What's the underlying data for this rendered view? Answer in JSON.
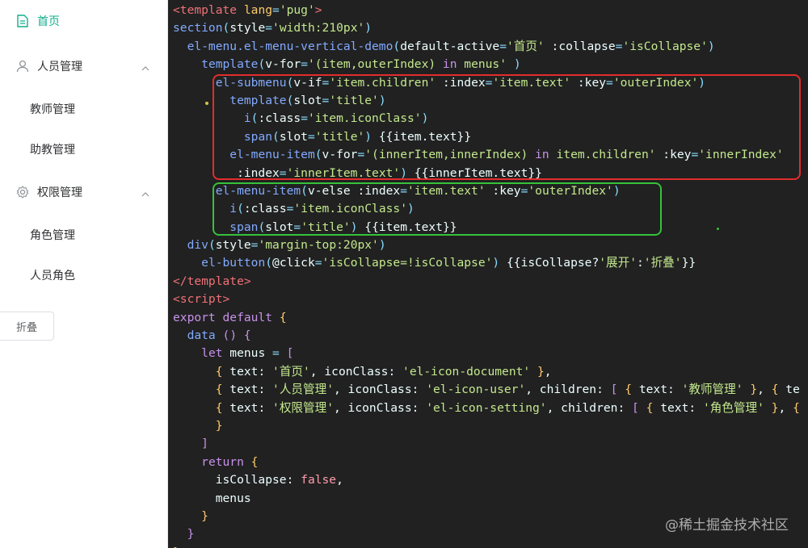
{
  "sidebar": {
    "items": [
      {
        "label": "首页",
        "icon": "document-icon",
        "active": true
      },
      {
        "label": "人员管理",
        "icon": "user-icon",
        "children": [
          "教师管理",
          "助教管理"
        ]
      },
      {
        "label": "权限管理",
        "icon": "setting-icon",
        "children": [
          "角色管理",
          "人员角色"
        ]
      }
    ],
    "collapse_button": "折叠",
    "accent_color": "#13ae8c"
  },
  "editor": {
    "lines": [
      [
        [
          "tag",
          "<template "
        ],
        [
          "prop",
          "lang"
        ],
        [
          "punc",
          "="
        ],
        [
          "str",
          "'pug'"
        ],
        [
          "tag",
          ">"
        ]
      ],
      [
        [
          "fn",
          "section"
        ],
        [
          "punc",
          "("
        ],
        [
          "plain",
          "style"
        ],
        [
          "punc",
          "="
        ],
        [
          "str",
          "'width:210px'"
        ],
        [
          "punc",
          ")"
        ]
      ],
      [
        [
          "plain",
          "  "
        ],
        [
          "fn",
          "el-menu.el-menu-vertical-demo"
        ],
        [
          "punc",
          "("
        ],
        [
          "plain",
          "default-active"
        ],
        [
          "punc",
          "="
        ],
        [
          "str",
          "'首页'"
        ],
        [
          "plain",
          " :collapse"
        ],
        [
          "punc",
          "="
        ],
        [
          "str",
          "'isCollapse'"
        ],
        [
          "punc",
          ")"
        ]
      ],
      [
        [
          "plain",
          "    "
        ],
        [
          "fn",
          "template"
        ],
        [
          "punc",
          "("
        ],
        [
          "plain",
          "v-for"
        ],
        [
          "punc",
          "="
        ],
        [
          "str",
          "'(item,outerIndex) "
        ],
        [
          "kw",
          "in"
        ],
        [
          "str",
          " menus'"
        ],
        [
          "plain",
          " "
        ],
        [
          "punc",
          ")"
        ]
      ],
      [
        [
          "plain",
          "      "
        ],
        [
          "fn",
          "el-submenu"
        ],
        [
          "punc",
          "("
        ],
        [
          "plain",
          "v-if"
        ],
        [
          "punc",
          "="
        ],
        [
          "str",
          "'item.children'"
        ],
        [
          "plain",
          " :index"
        ],
        [
          "punc",
          "="
        ],
        [
          "str",
          "'item.text'"
        ],
        [
          "plain",
          " :key"
        ],
        [
          "punc",
          "="
        ],
        [
          "str",
          "'outerIndex'"
        ],
        [
          "punc",
          ")"
        ]
      ],
      [
        [
          "plain",
          "        "
        ],
        [
          "fn",
          "template"
        ],
        [
          "punc",
          "("
        ],
        [
          "plain",
          "slot"
        ],
        [
          "punc",
          "="
        ],
        [
          "str",
          "'title'"
        ],
        [
          "punc",
          ")"
        ]
      ],
      [
        [
          "plain",
          "          "
        ],
        [
          "fn",
          "i"
        ],
        [
          "punc",
          "("
        ],
        [
          "plain",
          ":class"
        ],
        [
          "punc",
          "="
        ],
        [
          "str",
          "'item.iconClass'"
        ],
        [
          "punc",
          ")"
        ]
      ],
      [
        [
          "plain",
          "          "
        ],
        [
          "fn",
          "span"
        ],
        [
          "punc",
          "("
        ],
        [
          "plain",
          "slot"
        ],
        [
          "punc",
          "="
        ],
        [
          "str",
          "'title'"
        ],
        [
          "punc",
          ")"
        ],
        [
          "plain",
          " {{item.text}}"
        ]
      ],
      [
        [
          "plain",
          "        "
        ],
        [
          "fn",
          "el-menu-item"
        ],
        [
          "punc",
          "("
        ],
        [
          "plain",
          "v-for"
        ],
        [
          "punc",
          "="
        ],
        [
          "str",
          "'(innerItem,innerIndex) "
        ],
        [
          "kw",
          "in"
        ],
        [
          "str",
          " item.children'"
        ],
        [
          "plain",
          " :key"
        ],
        [
          "punc",
          "="
        ],
        [
          "str",
          "'innerIndex'"
        ]
      ],
      [
        [
          "plain",
          "         :index"
        ],
        [
          "punc",
          "="
        ],
        [
          "str",
          "'innerItem.text'"
        ],
        [
          "punc",
          ")"
        ],
        [
          "plain",
          " {{innerItem.text}}"
        ]
      ],
      [
        [
          "plain",
          "      "
        ],
        [
          "fn",
          "el-menu-item"
        ],
        [
          "punc",
          "("
        ],
        [
          "plain",
          "v-else :index"
        ],
        [
          "punc",
          "="
        ],
        [
          "str",
          "'item.text'"
        ],
        [
          "plain",
          " :key"
        ],
        [
          "punc",
          "="
        ],
        [
          "str",
          "'outerIndex'"
        ],
        [
          "punc",
          ")"
        ]
      ],
      [
        [
          "plain",
          "        "
        ],
        [
          "fn",
          "i"
        ],
        [
          "punc",
          "("
        ],
        [
          "plain",
          ":class"
        ],
        [
          "punc",
          "="
        ],
        [
          "str",
          "'item.iconClass'"
        ],
        [
          "punc",
          ")"
        ]
      ],
      [
        [
          "plain",
          "        "
        ],
        [
          "fn",
          "span"
        ],
        [
          "punc",
          "("
        ],
        [
          "plain",
          "slot"
        ],
        [
          "punc",
          "="
        ],
        [
          "str",
          "'title'"
        ],
        [
          "punc",
          ")"
        ],
        [
          "plain",
          " {{item.text}}"
        ]
      ],
      [
        [
          "plain",
          "  "
        ],
        [
          "fn",
          "div"
        ],
        [
          "punc",
          "("
        ],
        [
          "plain",
          "style"
        ],
        [
          "punc",
          "="
        ],
        [
          "str",
          "'margin-top:20px'"
        ],
        [
          "punc",
          ")"
        ]
      ],
      [
        [
          "plain",
          "    "
        ],
        [
          "fn",
          "el-button"
        ],
        [
          "punc",
          "("
        ],
        [
          "plain",
          "@click"
        ],
        [
          "punc",
          "="
        ],
        [
          "str",
          "'isCollapse=!isCollapse'"
        ],
        [
          "punc",
          ")"
        ],
        [
          "plain",
          " {{isCollapse?"
        ],
        [
          "str",
          "'展开'"
        ],
        [
          "plain",
          ":"
        ],
        [
          "str",
          "'折叠'"
        ],
        [
          "plain",
          "}}"
        ]
      ],
      [
        [
          "tag",
          "</template>"
        ]
      ],
      [
        [
          "tag",
          "<script>"
        ]
      ],
      [
        [
          "kw",
          "export default"
        ],
        [
          "plain",
          " "
        ],
        [
          "prop",
          "{"
        ]
      ],
      [
        [
          "plain",
          "  "
        ],
        [
          "fn",
          "data"
        ],
        [
          "plain",
          " "
        ],
        [
          "kw",
          "()"
        ],
        [
          "plain",
          " "
        ],
        [
          "kw",
          "{"
        ]
      ],
      [
        [
          "plain",
          "    "
        ],
        [
          "kw",
          "let"
        ],
        [
          "plain",
          " menus "
        ],
        [
          "punc",
          "="
        ],
        [
          "plain",
          " "
        ],
        [
          "kw",
          "["
        ]
      ],
      [
        [
          "plain",
          "      "
        ],
        [
          "prop",
          "{"
        ],
        [
          "plain",
          " text: "
        ],
        [
          "str",
          "'首页'"
        ],
        [
          "plain",
          ", iconClass: "
        ],
        [
          "str",
          "'el-icon-document'"
        ],
        [
          "plain",
          " "
        ],
        [
          "prop",
          "}"
        ],
        [
          "plain",
          ","
        ]
      ],
      [
        [
          "plain",
          "      "
        ],
        [
          "prop",
          "{"
        ],
        [
          "plain",
          " text: "
        ],
        [
          "str",
          "'人员管理'"
        ],
        [
          "plain",
          ", iconClass: "
        ],
        [
          "str",
          "'el-icon-user'"
        ],
        [
          "plain",
          ", children: "
        ],
        [
          "kw",
          "["
        ],
        [
          "plain",
          " "
        ],
        [
          "prop",
          "{"
        ],
        [
          "plain",
          " text: "
        ],
        [
          "str",
          "'教师管理'"
        ],
        [
          "plain",
          " "
        ],
        [
          "prop",
          "}"
        ],
        [
          "plain",
          ", "
        ],
        [
          "prop",
          "{"
        ],
        [
          "plain",
          " te"
        ]
      ],
      [
        [
          "plain",
          "      "
        ],
        [
          "prop",
          "{"
        ],
        [
          "plain",
          " text: "
        ],
        [
          "str",
          "'权限管理'"
        ],
        [
          "plain",
          ", iconClass: "
        ],
        [
          "str",
          "'el-icon-setting'"
        ],
        [
          "plain",
          ", children: "
        ],
        [
          "kw",
          "["
        ],
        [
          "plain",
          " "
        ],
        [
          "prop",
          "{"
        ],
        [
          "plain",
          " text: "
        ],
        [
          "str",
          "'角色管理'"
        ],
        [
          "plain",
          " "
        ],
        [
          "prop",
          "}"
        ],
        [
          "plain",
          ", "
        ],
        [
          "prop",
          "{"
        ]
      ],
      [
        [
          "plain",
          "      "
        ],
        [
          "prop",
          "}"
        ]
      ],
      [
        [
          "plain",
          "    "
        ],
        [
          "kw",
          "]"
        ]
      ],
      [
        [
          "plain",
          "    "
        ],
        [
          "kw",
          "return"
        ],
        [
          "plain",
          " "
        ],
        [
          "prop",
          "{"
        ]
      ],
      [
        [
          "plain",
          "      isCollapse: "
        ],
        [
          "bool",
          "false"
        ],
        [
          "plain",
          ","
        ]
      ],
      [
        [
          "plain",
          "      menus"
        ]
      ],
      [
        [
          "plain",
          "    "
        ],
        [
          "prop",
          "}"
        ]
      ],
      [
        [
          "plain",
          "  "
        ],
        [
          "kw",
          "}"
        ]
      ],
      [
        [
          "plain",
          ""
        ],
        [
          "prop",
          "}"
        ]
      ]
    ]
  },
  "watermark": "@稀土掘金技术社区"
}
